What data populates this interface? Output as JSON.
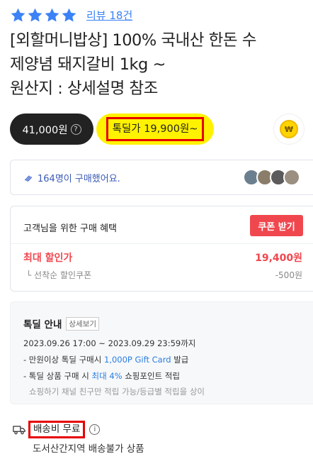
{
  "rating": {
    "stars": 4,
    "review_link": "리뷰 18건"
  },
  "title_lines": [
    "[외할머니밥상] 100% 국내산 한돈 수",
    "제양념 돼지갈비 1kg ~",
    "원산지 : 상세설명 참조"
  ],
  "price": {
    "original": "41,000원",
    "deal_label": "톡딜가",
    "deal_price": "19,900원~"
  },
  "buyers": {
    "text": "164명이 구매했어요."
  },
  "benefit": {
    "heading": "고객님을 위한 구매 혜택",
    "coupon_button": "쿠폰 받기",
    "max_discount_label": "최대 할인가",
    "max_discount_value": "19,400원",
    "coupon_label": "선착순 할인쿠폰",
    "coupon_value": "-500원"
  },
  "deal_info": {
    "heading": "톡딜 안내",
    "detail_button": "상세보기",
    "period": "2023.09.26 17:00 ~ 2023.09.29 23:59까지",
    "line1_pre": "- 만원이상 톡딜 구매시 ",
    "line1_hl": "1,000P Gift Card",
    "line1_post": " 발급",
    "line2_pre": "- 톡딜 상품 구매 시 ",
    "line2_hl": "최대 4%",
    "line2_post": " 쇼핑포인트 적립",
    "note": "쇼핑하기 채널 친구만 적립 가능/등급별 적립을 상이"
  },
  "shipping": {
    "label": "배송비 무료",
    "note": "도서산간지역 배송불가 상품"
  },
  "colors": {
    "star": "#3b82f6",
    "accent_red": "#f0474f",
    "deal_yellow": "#fff200",
    "highlight_border": "#e60000"
  }
}
